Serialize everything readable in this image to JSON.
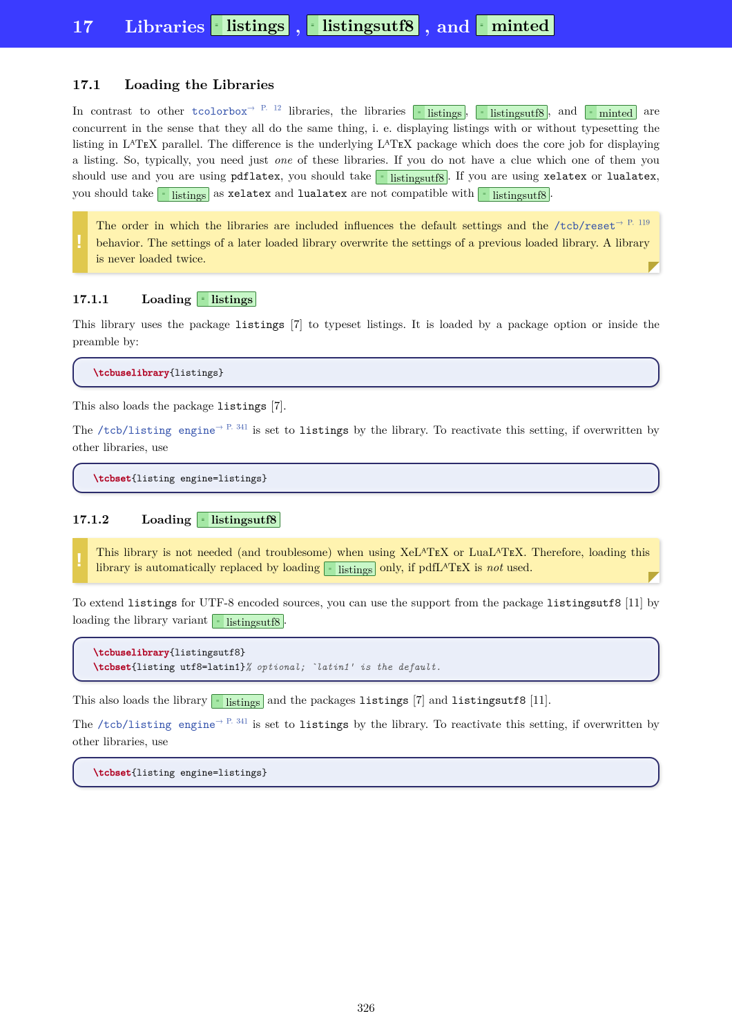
{
  "header": {
    "num": "17",
    "word_libraries": "Libraries",
    "lib1": "listings",
    "comma1": ",",
    "lib2": "listingsutf8",
    "comma_and": ", and",
    "lib3": "minted"
  },
  "s171": {
    "num": "17.1",
    "title": "Loading the Libraries",
    "p1a": "In contrast to other ",
    "tcolorbox": "tcolorbox",
    "tcolorbox_ref": "→ P. 12",
    "p1b": " libraries, the libraries ",
    "lib_listings": "listings",
    "p1c": ", ",
    "lib_listingsutf8": "listingsutf8",
    "p1d": ", and ",
    "lib_minted": "minted",
    "p1e": " are concurrent in the sense that they all do the same thing, i. e. displaying listings with or without typesetting the listing in LᴬTᴇX parallel. The difference is the underlying LᴬTᴇX package which does the core job for displaying a listing. So, typically, you need just ",
    "p1_one": "one",
    "p1f": " of these libraries. If you do not have a clue which one of them you should use and you are using ",
    "pdflatex": "pdflatex",
    "p1g": ", you should take ",
    "p1h": ". If you are using ",
    "xelatex": "xelatex",
    "p1_or": " or ",
    "lualatex": "lualatex",
    "p1i": ", you should take ",
    "p1j": " as ",
    "p1_and": " and ",
    "p1k": " are not compatible with ",
    "p1l": "."
  },
  "warn1": {
    "a": "The order in which the libraries are included influences the default settings and the ",
    "reset": "/tcb/reset",
    "reset_ref": "→ P. 119",
    "b": " behavior. The settings of a later loaded library overwrite the settings of a previous loaded library. A library is never loaded twice."
  },
  "s1711": {
    "num": "17.1.1",
    "word_loading": "Loading",
    "lib": "listings",
    "p1a": "This library uses the package ",
    "pkg": "listings",
    "p1b": " [7] to typeset listings. It is loaded by a package option or inside the preamble by:",
    "code1_cmd": "\\tcbuselibrary",
    "code1_arg": "{listings}",
    "p2a": "This also loads the package ",
    "p2b": " [7].",
    "p3a": "The ",
    "engine": "/tcb/listing engine",
    "engine_ref": "→ P. 341",
    "p3b": " is set to ",
    "p3_val": "listings",
    "p3c": " by the library. To reactivate this setting, if overwritten by other libraries, use",
    "code2_cmd": "\\tcbset",
    "code2_arg": "{listing engine=listings}"
  },
  "s1712": {
    "num": "17.1.2",
    "word_loading": "Loading",
    "lib": "listingsutf8",
    "warn_a": "This library is not needed (and troublesome) when using XeLᴬTᴇX or LuaLᴬTᴇX. Therefore, loading this library is automatically replaced by loading ",
    "warn_lib": "listings",
    "warn_b": " only, if pdfLᴬTᴇX is ",
    "warn_not": "not",
    "warn_c": " used.",
    "p1a": "To extend ",
    "p1_pkg": "listings",
    "p1b": " for UTF-8 encoded sources, you can use the support from the package ",
    "p1_pkg2": "listingsutf8",
    "p1c": " [11] by loading the library variant ",
    "p1d": ".",
    "code1_cmd1": "\\tcbuselibrary",
    "code1_arg1": "{listingsutf8}",
    "code1_cmd2": "\\tcbset",
    "code1_arg2": "{listing utf8=latin1}",
    "code1_comment": "% optional; `latin1' is the default.",
    "p2a": "This also loads the library ",
    "p2b": " and the packages ",
    "p2c": " [7] and ",
    "p2d": " [11].",
    "p3a": "The ",
    "engine": "/tcb/listing engine",
    "engine_ref": "→ P. 341",
    "p3b": " is set to ",
    "p3_val": "listings",
    "p3c": " by the library. To reactivate this setting, if overwritten by other libraries, use",
    "code2_cmd": "\\tcbset",
    "code2_arg": "{listing engine=listings}"
  },
  "pagenum": "326"
}
